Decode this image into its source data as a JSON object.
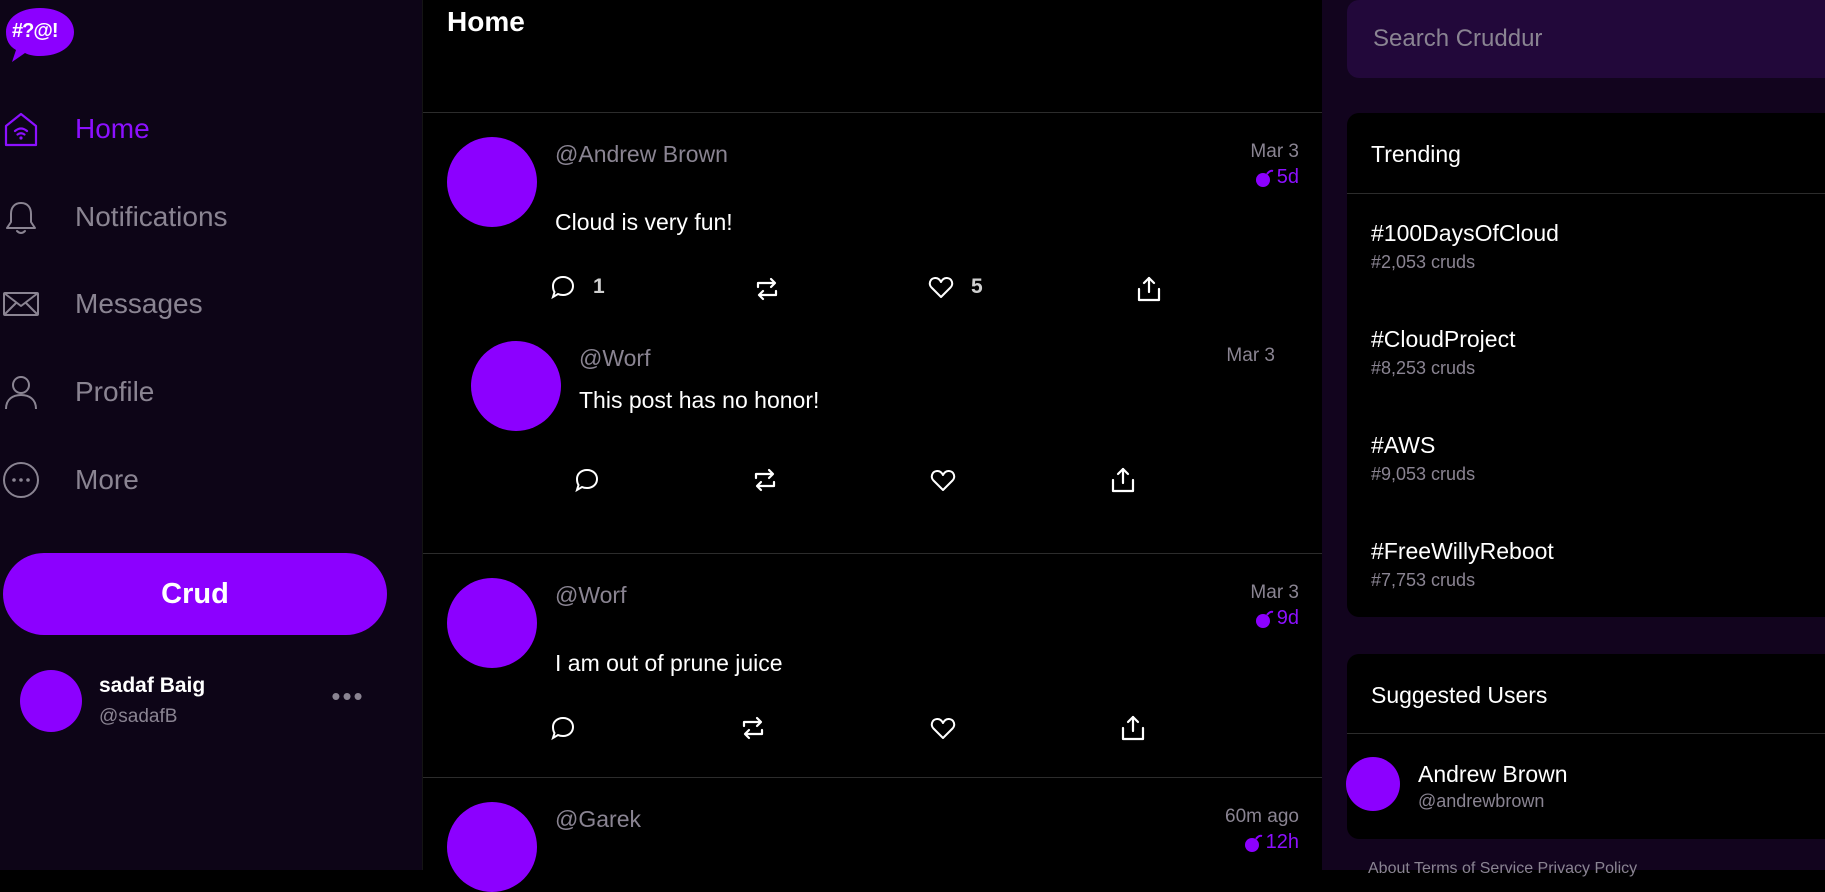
{
  "logo": {
    "text": "#?@!"
  },
  "nav": {
    "items": [
      {
        "label": "Home",
        "icon": "home-icon",
        "active": true
      },
      {
        "label": "Notifications",
        "icon": "bell-icon",
        "active": false
      },
      {
        "label": "Messages",
        "icon": "envelope-icon",
        "active": false
      },
      {
        "label": "Profile",
        "icon": "user-icon",
        "active": false
      },
      {
        "label": "More",
        "icon": "more-circle-icon",
        "active": false
      }
    ],
    "crud_label": "Crud"
  },
  "me": {
    "name": "sadaf Baig",
    "handle": "@sadafB",
    "menu": "•••"
  },
  "main": {
    "title": "Home",
    "posts": [
      {
        "handle": "@Andrew Brown",
        "date": "Mar 3",
        "ttl": "5d",
        "body": "Cloud is very fun!",
        "replies": "1",
        "likes": "5"
      },
      {
        "handle": "@Worf",
        "date": "Mar 3",
        "body": "This post has no honor!"
      },
      {
        "handle": "@Worf",
        "date": "Mar 3",
        "ttl": "9d",
        "body": "I am out of prune juice"
      },
      {
        "handle": "@Garek",
        "date": "60m ago",
        "ttl": "12h"
      }
    ]
  },
  "right": {
    "search_placeholder": "Search Cruddur",
    "trending_title": "Trending",
    "trends": [
      {
        "tag": "#100DaysOfCloud",
        "count": "#2,053 cruds"
      },
      {
        "tag": "#CloudProject",
        "count": "#8,253 cruds"
      },
      {
        "tag": "#AWS",
        "count": "#9,053 cruds"
      },
      {
        "tag": "#FreeWillyReboot",
        "count": "#7,753 cruds"
      }
    ],
    "suggested_title": "Suggested Users",
    "suggested": [
      {
        "name": "Andrew Brown",
        "handle": "@andrewbrown"
      }
    ],
    "footer": "About   Terms of Service   Privacy Policy"
  },
  "colors": {
    "accent": "#8c00ff",
    "sidebar_bg": "#0d0517",
    "right_bg": "#12041e",
    "muted": "#8a8492"
  }
}
